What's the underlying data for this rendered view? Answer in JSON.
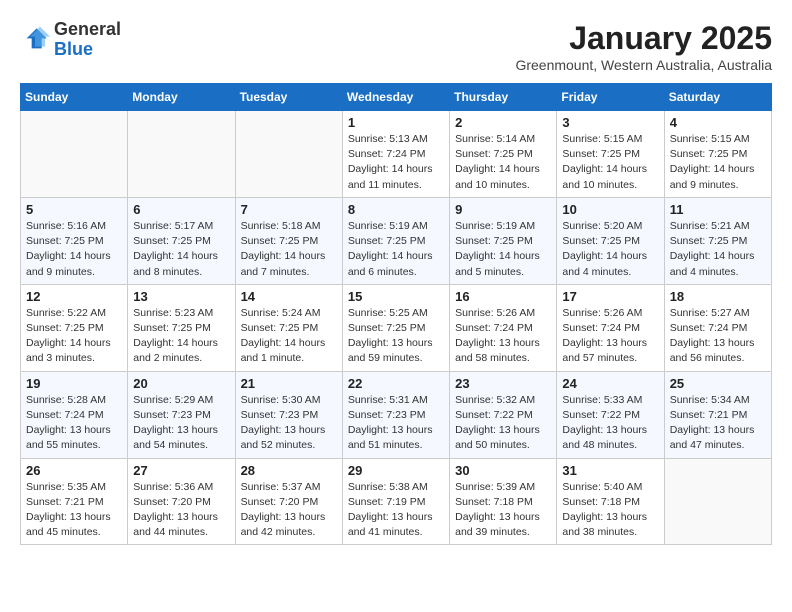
{
  "logo": {
    "general": "General",
    "blue": "Blue"
  },
  "header": {
    "month": "January 2025",
    "location": "Greenmount, Western Australia, Australia"
  },
  "days_of_week": [
    "Sunday",
    "Monday",
    "Tuesday",
    "Wednesday",
    "Thursday",
    "Friday",
    "Saturday"
  ],
  "weeks": [
    [
      {
        "day": "",
        "info": ""
      },
      {
        "day": "",
        "info": ""
      },
      {
        "day": "",
        "info": ""
      },
      {
        "day": "1",
        "info": "Sunrise: 5:13 AM\nSunset: 7:24 PM\nDaylight: 14 hours\nand 11 minutes."
      },
      {
        "day": "2",
        "info": "Sunrise: 5:14 AM\nSunset: 7:25 PM\nDaylight: 14 hours\nand 10 minutes."
      },
      {
        "day": "3",
        "info": "Sunrise: 5:15 AM\nSunset: 7:25 PM\nDaylight: 14 hours\nand 10 minutes."
      },
      {
        "day": "4",
        "info": "Sunrise: 5:15 AM\nSunset: 7:25 PM\nDaylight: 14 hours\nand 9 minutes."
      }
    ],
    [
      {
        "day": "5",
        "info": "Sunrise: 5:16 AM\nSunset: 7:25 PM\nDaylight: 14 hours\nand 9 minutes."
      },
      {
        "day": "6",
        "info": "Sunrise: 5:17 AM\nSunset: 7:25 PM\nDaylight: 14 hours\nand 8 minutes."
      },
      {
        "day": "7",
        "info": "Sunrise: 5:18 AM\nSunset: 7:25 PM\nDaylight: 14 hours\nand 7 minutes."
      },
      {
        "day": "8",
        "info": "Sunrise: 5:19 AM\nSunset: 7:25 PM\nDaylight: 14 hours\nand 6 minutes."
      },
      {
        "day": "9",
        "info": "Sunrise: 5:19 AM\nSunset: 7:25 PM\nDaylight: 14 hours\nand 5 minutes."
      },
      {
        "day": "10",
        "info": "Sunrise: 5:20 AM\nSunset: 7:25 PM\nDaylight: 14 hours\nand 4 minutes."
      },
      {
        "day": "11",
        "info": "Sunrise: 5:21 AM\nSunset: 7:25 PM\nDaylight: 14 hours\nand 4 minutes."
      }
    ],
    [
      {
        "day": "12",
        "info": "Sunrise: 5:22 AM\nSunset: 7:25 PM\nDaylight: 14 hours\nand 3 minutes."
      },
      {
        "day": "13",
        "info": "Sunrise: 5:23 AM\nSunset: 7:25 PM\nDaylight: 14 hours\nand 2 minutes."
      },
      {
        "day": "14",
        "info": "Sunrise: 5:24 AM\nSunset: 7:25 PM\nDaylight: 14 hours\nand 1 minute."
      },
      {
        "day": "15",
        "info": "Sunrise: 5:25 AM\nSunset: 7:25 PM\nDaylight: 13 hours\nand 59 minutes."
      },
      {
        "day": "16",
        "info": "Sunrise: 5:26 AM\nSunset: 7:24 PM\nDaylight: 13 hours\nand 58 minutes."
      },
      {
        "day": "17",
        "info": "Sunrise: 5:26 AM\nSunset: 7:24 PM\nDaylight: 13 hours\nand 57 minutes."
      },
      {
        "day": "18",
        "info": "Sunrise: 5:27 AM\nSunset: 7:24 PM\nDaylight: 13 hours\nand 56 minutes."
      }
    ],
    [
      {
        "day": "19",
        "info": "Sunrise: 5:28 AM\nSunset: 7:24 PM\nDaylight: 13 hours\nand 55 minutes."
      },
      {
        "day": "20",
        "info": "Sunrise: 5:29 AM\nSunset: 7:23 PM\nDaylight: 13 hours\nand 54 minutes."
      },
      {
        "day": "21",
        "info": "Sunrise: 5:30 AM\nSunset: 7:23 PM\nDaylight: 13 hours\nand 52 minutes."
      },
      {
        "day": "22",
        "info": "Sunrise: 5:31 AM\nSunset: 7:23 PM\nDaylight: 13 hours\nand 51 minutes."
      },
      {
        "day": "23",
        "info": "Sunrise: 5:32 AM\nSunset: 7:22 PM\nDaylight: 13 hours\nand 50 minutes."
      },
      {
        "day": "24",
        "info": "Sunrise: 5:33 AM\nSunset: 7:22 PM\nDaylight: 13 hours\nand 48 minutes."
      },
      {
        "day": "25",
        "info": "Sunrise: 5:34 AM\nSunset: 7:21 PM\nDaylight: 13 hours\nand 47 minutes."
      }
    ],
    [
      {
        "day": "26",
        "info": "Sunrise: 5:35 AM\nSunset: 7:21 PM\nDaylight: 13 hours\nand 45 minutes."
      },
      {
        "day": "27",
        "info": "Sunrise: 5:36 AM\nSunset: 7:20 PM\nDaylight: 13 hours\nand 44 minutes."
      },
      {
        "day": "28",
        "info": "Sunrise: 5:37 AM\nSunset: 7:20 PM\nDaylight: 13 hours\nand 42 minutes."
      },
      {
        "day": "29",
        "info": "Sunrise: 5:38 AM\nSunset: 7:19 PM\nDaylight: 13 hours\nand 41 minutes."
      },
      {
        "day": "30",
        "info": "Sunrise: 5:39 AM\nSunset: 7:18 PM\nDaylight: 13 hours\nand 39 minutes."
      },
      {
        "day": "31",
        "info": "Sunrise: 5:40 AM\nSunset: 7:18 PM\nDaylight: 13 hours\nand 38 minutes."
      },
      {
        "day": "",
        "info": ""
      }
    ]
  ]
}
